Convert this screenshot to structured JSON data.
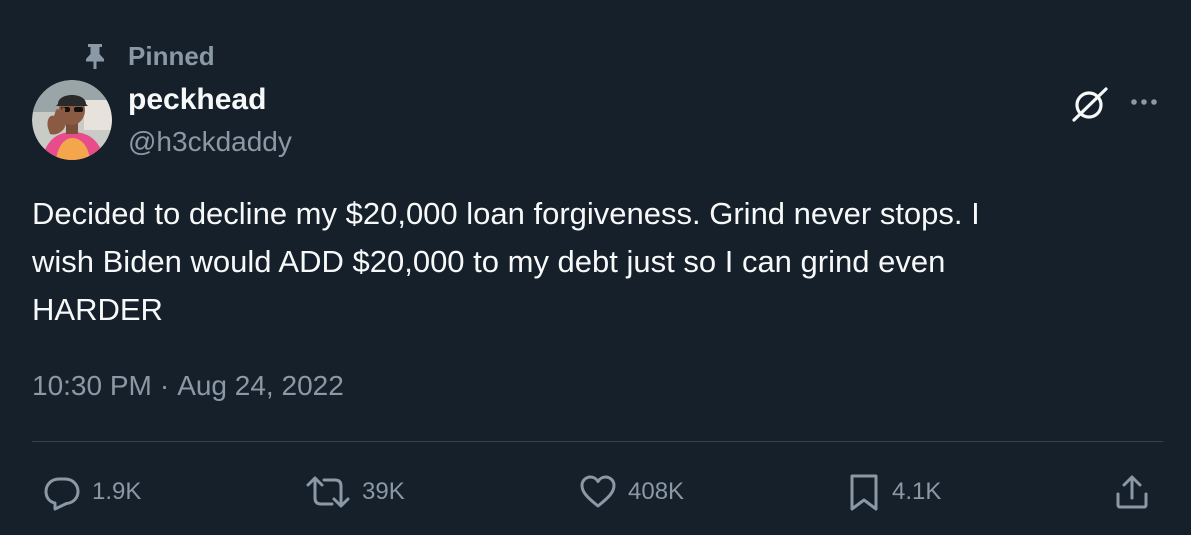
{
  "pinned": {
    "label": "Pinned",
    "icon": "pin-icon"
  },
  "author": {
    "display_name": "peckhead",
    "handle": "@h3ckdaddy",
    "avatar": "avatar-photo"
  },
  "header_actions": {
    "grok_icon": "grok-icon",
    "more_icon": "more-icon"
  },
  "tweet": {
    "text": "Decided to decline my $20,000 loan forgiveness. Grind never stops. I\nwish Biden would ADD $20,000 to my debt just so I can grind even\nHARDER",
    "time": "10:30 PM",
    "separator": "·",
    "date": "Aug 24, 2022"
  },
  "actions": {
    "reply": {
      "icon": "reply-icon",
      "count": "1.9K"
    },
    "retweet": {
      "icon": "retweet-icon",
      "count": "39K"
    },
    "like": {
      "icon": "heart-icon",
      "count": "408K"
    },
    "bookmark": {
      "icon": "bookmark-icon",
      "count": "4.1K"
    },
    "share": {
      "icon": "share-icon"
    }
  },
  "colors": {
    "background": "#15202b",
    "text_primary": "#f7f9f9",
    "text_secondary": "#8b98a5",
    "divider": "#38444d"
  }
}
